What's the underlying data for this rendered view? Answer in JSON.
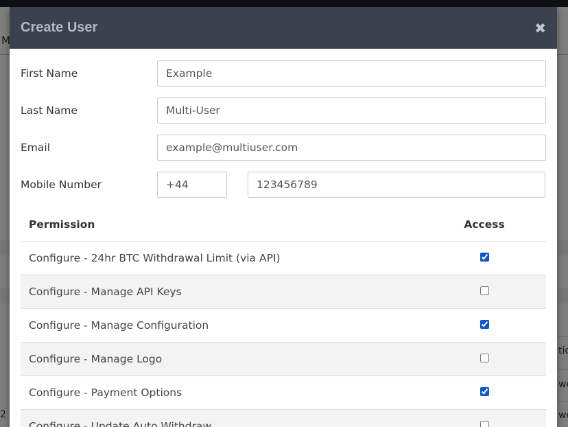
{
  "background": {
    "tab_fragment": "M",
    "right_fragments": [
      "tio",
      "we",
      "we"
    ],
    "left_fragment": "2"
  },
  "modal": {
    "title": "Create User",
    "close_glyph": "✖"
  },
  "form": {
    "first_name": {
      "label": "First Name",
      "value": "Example"
    },
    "last_name": {
      "label": "Last Name",
      "value": "Multi-User"
    },
    "email": {
      "label": "Email",
      "value": "example@multiuser.com"
    },
    "mobile": {
      "label": "Mobile Number",
      "code": "+44",
      "number": "123456789"
    }
  },
  "permissions": {
    "header_permission": "Permission",
    "header_access": "Access",
    "rows": [
      {
        "name": "Configure - 24hr BTC Withdrawal Limit (via API)",
        "checked": true
      },
      {
        "name": "Configure - Manage API Keys",
        "checked": false
      },
      {
        "name": "Configure - Manage Configuration",
        "checked": true
      },
      {
        "name": "Configure - Manage Logo",
        "checked": false
      },
      {
        "name": "Configure - Payment Options",
        "checked": true
      },
      {
        "name": "Configure - Update Auto Withdraw",
        "checked": false
      }
    ]
  },
  "colors": {
    "header_bg": "#3c4150",
    "checkbox_accent": "#0b57d0"
  }
}
